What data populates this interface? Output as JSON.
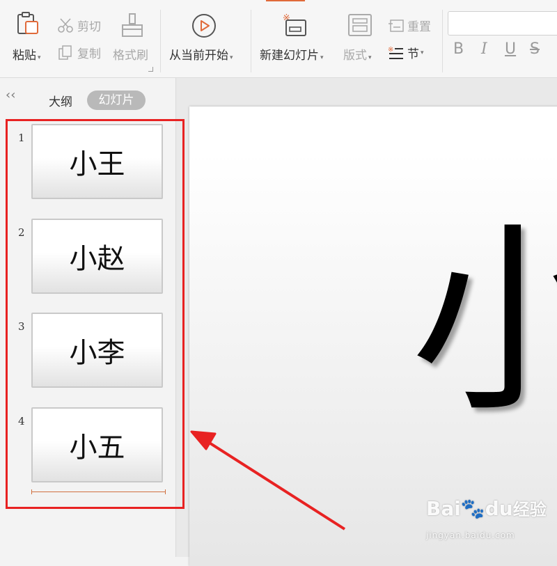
{
  "toolbar": {
    "paste_label": "粘贴",
    "cut_label": "剪切",
    "copy_label": "复制",
    "format_painter_label": "格式刷",
    "start_from_current_label": "从当前开始",
    "new_slide_label": "新建幻灯片",
    "layout_label": "版式",
    "reset_label": "重置",
    "section_label": "节",
    "format_buttons": [
      "B",
      "I",
      "U",
      "S"
    ],
    "font_name_value": ""
  },
  "panel": {
    "collapse_icon": "double-chevron-left-icon",
    "tabs": [
      {
        "label": "大纲",
        "active": false
      },
      {
        "label": "幻灯片",
        "active": true
      }
    ],
    "slides": [
      {
        "number": "1",
        "title": "小王"
      },
      {
        "number": "2",
        "title": "小赵"
      },
      {
        "number": "3",
        "title": "小李"
      },
      {
        "number": "4",
        "title": "小五"
      }
    ]
  },
  "canvas": {
    "slide_text": "小"
  },
  "annotation": {
    "highlight_color": "#e82222"
  },
  "watermark": {
    "brand": "Bai",
    "brand_suffix": "du",
    "brand_cn": "经验",
    "url": "jingyan.baidu.com"
  },
  "colors": {
    "accent": "#e06a3a",
    "tab_active_bg": "#b9b9b9"
  }
}
